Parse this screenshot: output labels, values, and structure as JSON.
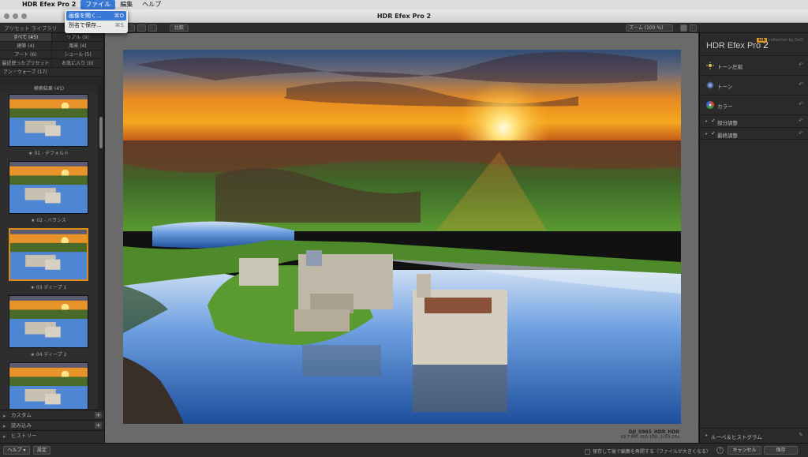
{
  "menubar": {
    "app": "HDR Efex Pro 2",
    "items": [
      "ファイル",
      "編集",
      "ヘルプ"
    ]
  },
  "file_menu": {
    "items": [
      {
        "label": "画像を開く...",
        "shortcut": "⌘O"
      },
      {
        "label": "別名で保存...",
        "shortcut": "⌘S"
      }
    ]
  },
  "window": {
    "title": "HDR Efex Pro 2"
  },
  "toolbar": {
    "left_label": "プリセット ライブラリ",
    "compare": "比較",
    "zoom": "ズーム (100 %)"
  },
  "left_panel": {
    "categories": [
      {
        "label": "すべて (45)",
        "active": true
      },
      {
        "label": "リアル (9)"
      },
      {
        "label": "建築 (4)"
      },
      {
        "label": "風景 (4)"
      },
      {
        "label": "アート (6)"
      },
      {
        "label": "シュール (5)"
      },
      {
        "label": "最近使ったプリセット"
      },
      {
        "label": "お気に入り (0)"
      },
      {
        "label": "アン・ウォーブ (17)",
        "full": true
      }
    ],
    "results_title": "検索結果 (45)",
    "presets": [
      {
        "label": "★ 01 - デフォルト"
      },
      {
        "label": "★ 02 - バランス"
      },
      {
        "label": "★ 03 ディープ 1"
      },
      {
        "label": "★ 04 ディープ 2"
      },
      {
        "label": ""
      }
    ],
    "custom": "カスタム",
    "import": "読み込み",
    "history": "ヒストリー"
  },
  "photo": {
    "filename": "DJI_0965_HDR_HDR",
    "info": "19.7 MP, ISO 100, 1/10-25s"
  },
  "right_panel": {
    "brand": "HDR Efex Pro",
    "brand_version": "2",
    "vendor": "nik",
    "vendor_sub": "collection by DxO",
    "sections": [
      {
        "label": "トーン圧縮",
        "icon": "sun-icon"
      },
      {
        "label": "トーン",
        "icon": "tone-icon"
      },
      {
        "label": "カラー",
        "icon": "color-wheel-icon"
      },
      {
        "label": "部分調整",
        "icon": "check-icon"
      },
      {
        "label": "最終調整",
        "icon": "check-icon"
      }
    ],
    "loupe": "ルーペ＆ヒストグラム"
  },
  "bottombar": {
    "help": "ヘルプ",
    "settings": "設定",
    "save_note": "保存して後で編集を再開する（ファイルが大きくなる）",
    "cancel": "キャンセル",
    "save": "保存"
  },
  "colors": {
    "accent": "#e08a17",
    "menu_highlight": "#3a78d6"
  }
}
